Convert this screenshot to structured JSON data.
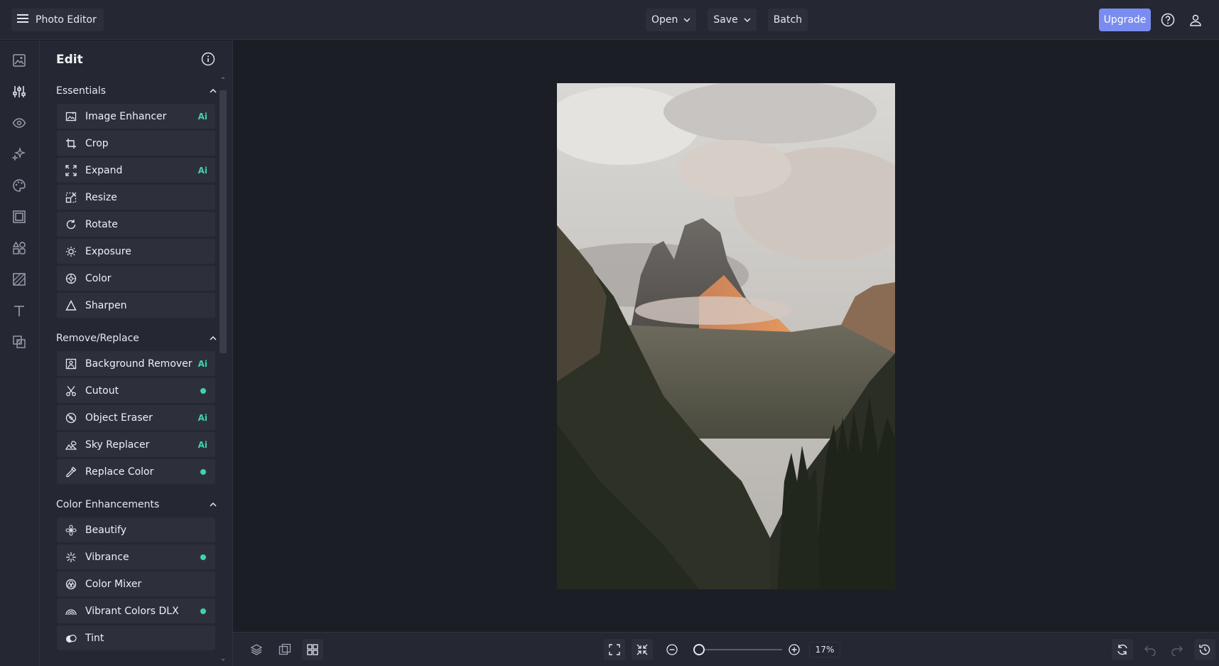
{
  "app": {
    "title": "Photo Editor"
  },
  "toolbar": {
    "open_label": "Open",
    "save_label": "Save",
    "batch_label": "Batch",
    "upgrade_label": "Upgrade"
  },
  "colors": {
    "accent": "#7b8cf0",
    "badge": "#3fd4a8",
    "bg": "#1c1e26",
    "panel": "#252832",
    "item": "#2d303b"
  },
  "rail": {
    "icons": [
      "image-icon",
      "sliders-icon",
      "eye-icon",
      "sparkles-icon",
      "palette-icon",
      "frame-icon",
      "shapes-icon",
      "texture-icon",
      "text-icon",
      "overlay-icon"
    ]
  },
  "panel": {
    "title": "Edit",
    "sections": [
      {
        "title": "Essentials",
        "items": [
          {
            "label": "Image Enhancer",
            "badge": "Ai",
            "icon": "enhance-icon"
          },
          {
            "label": "Crop",
            "badge": "",
            "icon": "crop-icon"
          },
          {
            "label": "Expand",
            "badge": "Ai",
            "icon": "expand-icon"
          },
          {
            "label": "Resize",
            "badge": "",
            "icon": "resize-icon"
          },
          {
            "label": "Rotate",
            "badge": "",
            "icon": "rotate-icon"
          },
          {
            "label": "Exposure",
            "badge": "",
            "icon": "sun-icon"
          },
          {
            "label": "Color",
            "badge": "",
            "icon": "color-icon"
          },
          {
            "label": "Sharpen",
            "badge": "",
            "icon": "triangle-icon"
          }
        ]
      },
      {
        "title": "Remove/Replace",
        "items": [
          {
            "label": "Background Remover",
            "badge": "Ai",
            "icon": "bg-remove-icon"
          },
          {
            "label": "Cutout",
            "badge": "dot",
            "icon": "scissors-icon"
          },
          {
            "label": "Object Eraser",
            "badge": "Ai",
            "icon": "eraser-icon"
          },
          {
            "label": "Sky Replacer",
            "badge": "Ai",
            "icon": "sky-icon"
          },
          {
            "label": "Replace Color",
            "badge": "dot",
            "icon": "dropper-icon"
          }
        ]
      },
      {
        "title": "Color Enhancements",
        "items": [
          {
            "label": "Beautify",
            "badge": "",
            "icon": "flower-icon"
          },
          {
            "label": "Vibrance",
            "badge": "dot",
            "icon": "sparkle-icon"
          },
          {
            "label": "Color Mixer",
            "badge": "",
            "icon": "mixer-icon"
          },
          {
            "label": "Vibrant Colors DLX",
            "badge": "dot",
            "icon": "rainbow-icon"
          },
          {
            "label": "Tint",
            "badge": "",
            "icon": "tint-icon"
          }
        ]
      }
    ]
  },
  "bottom": {
    "zoom": "17",
    "zoom_unit": "%",
    "zoom_fraction": 0.06
  }
}
